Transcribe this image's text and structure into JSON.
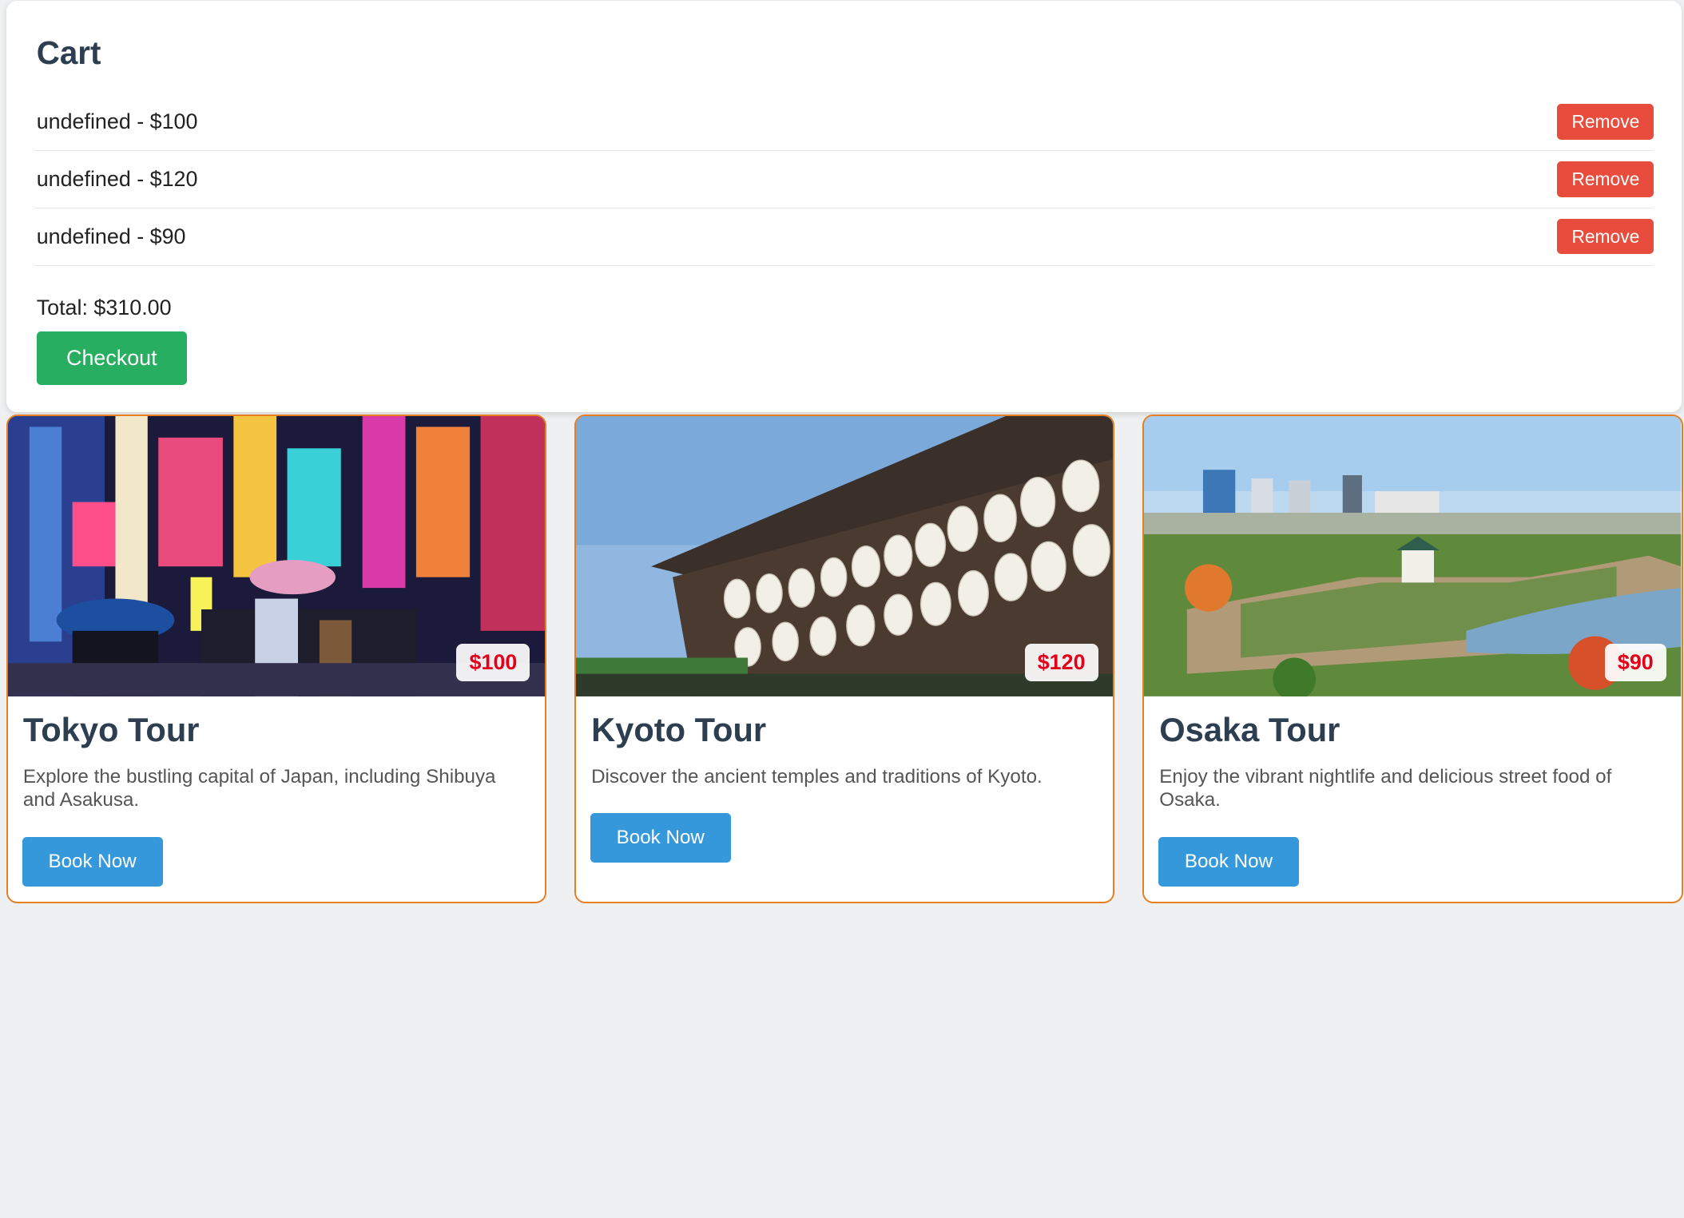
{
  "cart": {
    "title": "Cart",
    "items": [
      {
        "label": "undefined - $100",
        "remove_label": "Remove"
      },
      {
        "label": "undefined - $120",
        "remove_label": "Remove"
      },
      {
        "label": "undefined - $90",
        "remove_label": "Remove"
      }
    ],
    "total": "Total: $310.00",
    "checkout_label": "Checkout"
  },
  "tours": [
    {
      "title": "Tokyo Tour",
      "price": "$100",
      "description": "Explore the bustling capital of Japan, including Shibuya and Asakusa.",
      "button_label": "Book Now"
    },
    {
      "title": "Kyoto Tour",
      "price": "$120",
      "description": "Discover the ancient temples and traditions of Kyoto.",
      "button_label": "Book Now"
    },
    {
      "title": "Osaka Tour",
      "price": "$90",
      "description": "Enjoy the vibrant nightlife and delicious street food of Osaka.",
      "button_label": "Book Now"
    }
  ],
  "colors": {
    "remove": "#e74c3c",
    "checkout": "#27ae60",
    "book": "#3498db",
    "card_border": "#e67e22",
    "price": "#e3001b"
  }
}
